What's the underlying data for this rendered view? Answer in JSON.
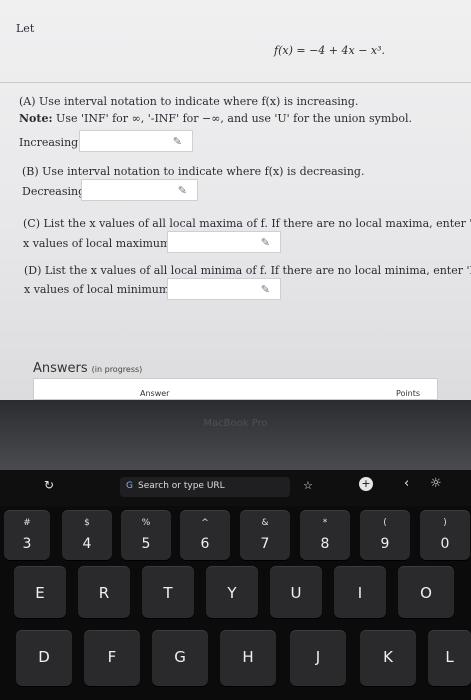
{
  "question": {
    "intro": "Let",
    "function": "f(x) = −4 + 4x − x³.",
    "partA": {
      "text": "(A) Use interval notation to indicate where f(x) is increasing.",
      "note_label": "Note:",
      "note_text": "Use 'INF' for ∞, '-INF' for −∞, and use 'U' for the union symbol.",
      "field_label": "Increasing:",
      "value": ""
    },
    "partB": {
      "text": "(B) Use interval notation to indicate where f(x) is decreasing.",
      "field_label": "Decreasing:",
      "value": ""
    },
    "partC": {
      "text": "(C) List the x values of all local maxima of f. If there are no local maxima, enter 'NONE'.",
      "field_label": "x values of local maximums =",
      "value": ""
    },
    "partD": {
      "text": "(D) List the x values of all local minima of f. If there are no local minima, enter 'NONE'.",
      "field_label": "x values of local minimums =",
      "value": ""
    }
  },
  "answers": {
    "heading": "Answers",
    "status": "(in progress)",
    "col_answer": "Answer",
    "col_points": "Points"
  },
  "bezel": {
    "brand": "MacBook Pro"
  },
  "touchbar": {
    "refresh": "↻",
    "search_placeholder": "Search or type URL",
    "star": "☆",
    "plus": "+",
    "back": "‹",
    "brightness": "☼"
  },
  "keyboard": {
    "number_row": [
      {
        "sym": "#",
        "main": "3"
      },
      {
        "sym": "$",
        "main": "4"
      },
      {
        "sym": "%",
        "main": "5"
      },
      {
        "sym": "^",
        "main": "6"
      },
      {
        "sym": "&",
        "main": "7"
      },
      {
        "sym": "*",
        "main": "8"
      },
      {
        "sym": "(",
        "main": "9"
      },
      {
        "sym": ")",
        "main": "0"
      }
    ],
    "row2": [
      "E",
      "R",
      "T",
      "Y",
      "U",
      "I",
      "O"
    ],
    "row3": [
      "D",
      "F",
      "G",
      "H",
      "J",
      "K",
      "L"
    ]
  }
}
